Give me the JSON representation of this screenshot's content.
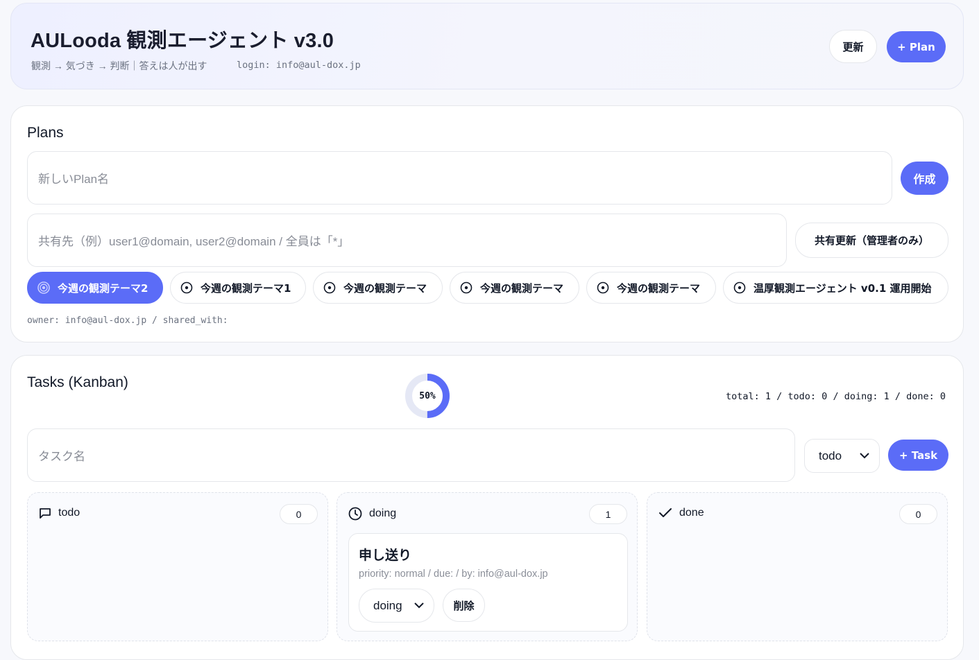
{
  "header": {
    "title": "AULooda 観測エージェント v3.0",
    "subtitle": "観測 → 気づき → 判断｜答えは人が出す",
    "login": "login: info@aul-dox.jp",
    "refresh_label": "更新",
    "new_plan_label": "+ Plan"
  },
  "plans": {
    "title": "Plans",
    "name_placeholder": "新しいPlan名",
    "create_label": "作成",
    "share_placeholder": "共有先（例）user1@domain, user2@domain / 全員は「*」",
    "share_update_label": "共有更新（管理者のみ）",
    "chips": [
      {
        "label": "今週の観測テーマ2",
        "active": true
      },
      {
        "label": "今週の観測テーマ1",
        "active": false
      },
      {
        "label": "今週の観測テーマ",
        "active": false
      },
      {
        "label": "今週の観測テーマ",
        "active": false
      },
      {
        "label": "今週の観測テーマ",
        "active": false
      },
      {
        "label": "温厚観測エージェント v0.1 運用開始",
        "active": false
      }
    ],
    "owner_line": "owner: info@aul-dox.jp / shared_with:"
  },
  "tasks": {
    "title": "Tasks (Kanban)",
    "progress_label": "50%",
    "progress_value": 0.5,
    "stats": "total: 1 / todo: 0 / doing: 1 / done: 0",
    "name_placeholder": "タスク名",
    "status_select": "todo",
    "add_label": "+ Task",
    "columns": [
      {
        "name": "todo",
        "count": "0",
        "icon": "message-icon"
      },
      {
        "name": "doing",
        "count": "1",
        "icon": "clock-icon"
      },
      {
        "name": "done",
        "count": "0",
        "icon": "check-icon"
      }
    ],
    "cards": [
      {
        "title": "申し送り",
        "meta": "priority: normal / due: / by: info@aul-dox.jp",
        "status": "doing",
        "delete_label": "削除"
      }
    ]
  },
  "colors": {
    "accent": "#5b6cf7",
    "progress_track": "#e5e8f5"
  }
}
